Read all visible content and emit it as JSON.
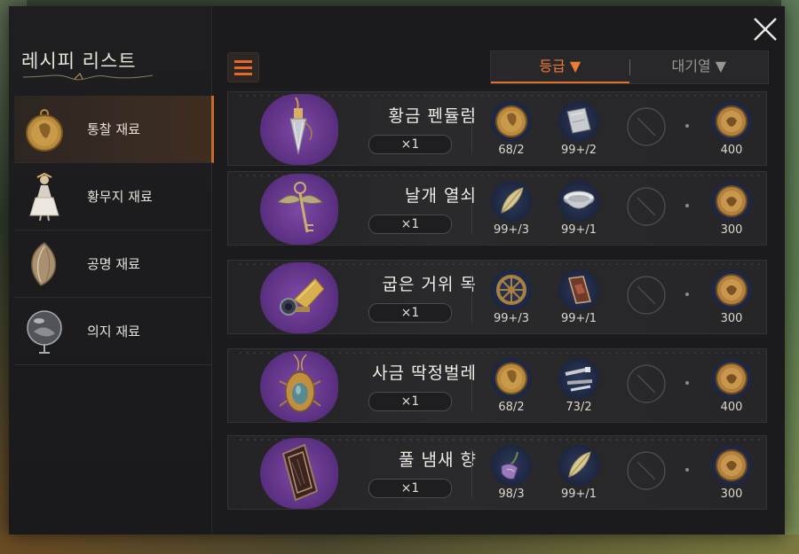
{
  "sidebar": {
    "title": "레시피 리스트",
    "items": [
      {
        "label": "통찰 재료",
        "icon": "coin-medal-icon",
        "active": true
      },
      {
        "label": "황무지 재료",
        "icon": "dress-figurine-icon",
        "active": false
      },
      {
        "label": "공명 재료",
        "icon": "seashell-icon",
        "active": false
      },
      {
        "label": "의지 재료",
        "icon": "glass-orb-icon",
        "active": false
      }
    ]
  },
  "sort": {
    "tabs": [
      {
        "label": "등급 ▼",
        "active": true
      },
      {
        "label": "대기열 ▼",
        "active": false
      }
    ]
  },
  "recipes": [
    {
      "name": "황금 펜듈럼",
      "quantity": "×1",
      "icon": "pendulum-icon",
      "materials": [
        {
          "icon": "gold-coin-icon",
          "count": "68/2"
        },
        {
          "icon": "metal-plate-icon",
          "count": "99+/2"
        }
      ],
      "cost": {
        "icon": "cost-coin-icon",
        "count": "400"
      }
    },
    {
      "name": "날개 열쇠",
      "quantity": "×1",
      "icon": "winged-key-icon",
      "materials": [
        {
          "icon": "feather-icon",
          "count": "99+/3"
        },
        {
          "icon": "bowl-icon",
          "count": "99+/1"
        }
      ],
      "cost": {
        "icon": "cost-coin-icon",
        "count": "300"
      }
    },
    {
      "name": "굽은 거위 목",
      "quantity": "×1",
      "icon": "goose-neck-icon",
      "materials": [
        {
          "icon": "gear-wheel-icon",
          "count": "99+/3"
        },
        {
          "icon": "plaque-icon",
          "count": "99+/1"
        }
      ],
      "cost": {
        "icon": "cost-coin-icon",
        "count": "300"
      }
    },
    {
      "name": "사금 딱정벌레",
      "quantity": "×1",
      "icon": "scarab-icon",
      "materials": [
        {
          "icon": "gold-coin-icon",
          "count": "68/2"
        },
        {
          "icon": "bolts-icon",
          "count": "73/2"
        }
      ],
      "cost": {
        "icon": "cost-coin-icon",
        "count": "400"
      }
    },
    {
      "name": "풀 냄새 향",
      "quantity": "×1",
      "icon": "incense-box-icon",
      "materials": [
        {
          "icon": "flower-bell-icon",
          "count": "98/3"
        },
        {
          "icon": "feather-icon",
          "count": "99+/1"
        }
      ],
      "cost": {
        "icon": "cost-coin-icon",
        "count": "300"
      }
    }
  ],
  "colors": {
    "accent": "#e56a2a",
    "item_bg": "#6a3a94",
    "panel": "#1b1b1d"
  }
}
